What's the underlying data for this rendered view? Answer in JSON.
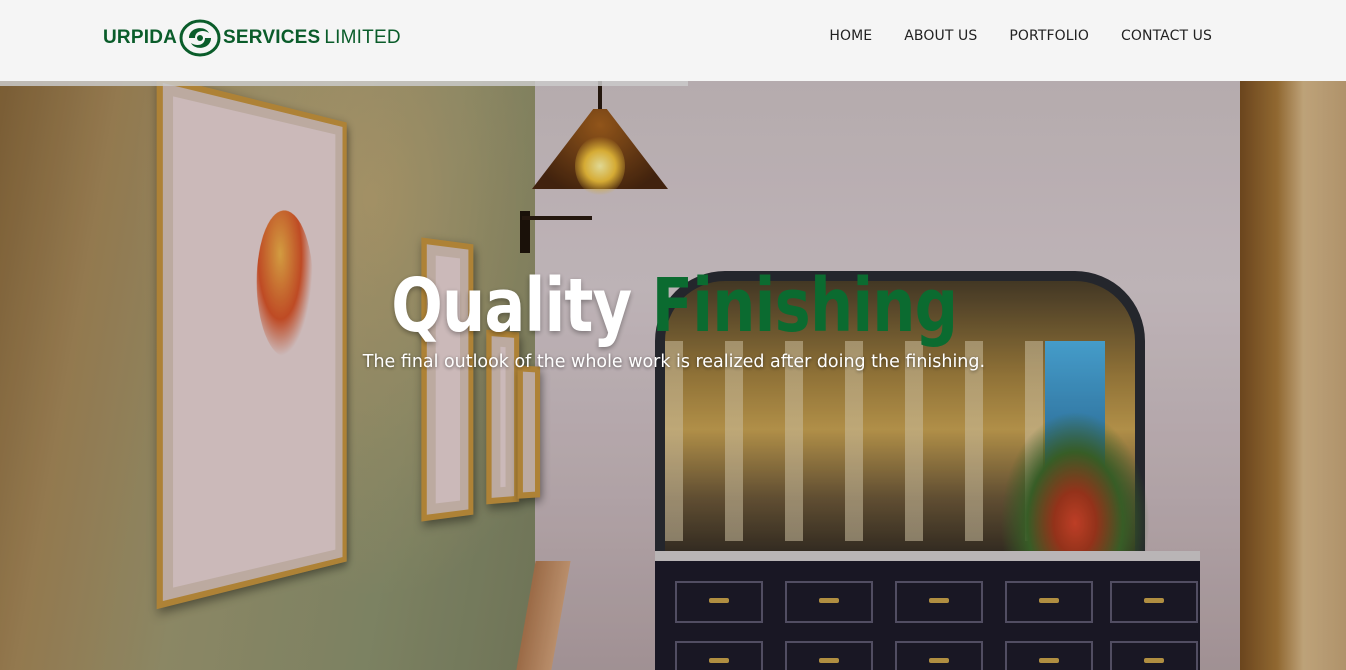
{
  "header": {
    "logo": {
      "word_left": "URPIDA",
      "word_right_bold": "SERVICES",
      "word_right_thin": "LIMITED",
      "brand_color": "#0a5c2a"
    },
    "nav": [
      {
        "label": "HOME"
      },
      {
        "label": "ABOUT US"
      },
      {
        "label": "PORTFOLIO"
      },
      {
        "label": "CONTACT US"
      }
    ]
  },
  "hero": {
    "headline_word1": "Quality",
    "headline_word2": "Finishing",
    "headline_accent_color": "#0b6b30",
    "subheading": "The final outlook of the whole work is realized after doing the finishing."
  }
}
